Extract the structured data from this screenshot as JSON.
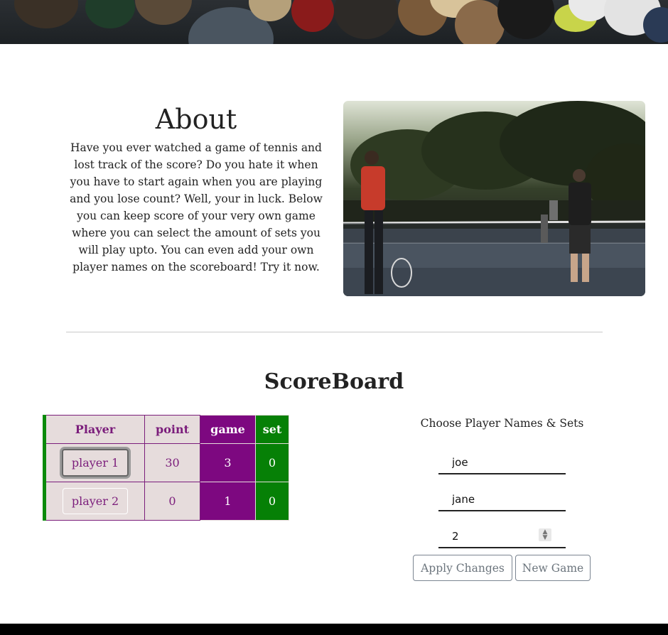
{
  "about": {
    "title": "About",
    "text": "Have you ever watched a game of tennis and lost track of the score? Do you hate it when you have to start again when you are playing and you lose count? Well, your in luck. Below you can keep score of your very own game where you can select the amount of sets you will play upto. You can even add your own player names on the scoreboard! Try it now."
  },
  "scoreboard": {
    "title": "ScoreBoard",
    "headers": {
      "player": "Player",
      "point": "point",
      "game": "game",
      "set": "set"
    },
    "rows": [
      {
        "player": "player 1",
        "point": "30",
        "game": "3",
        "set": "0"
      },
      {
        "player": "player 2",
        "point": "0",
        "game": "1",
        "set": "0"
      }
    ]
  },
  "form": {
    "title": "Choose Player Names & Sets",
    "player1_value": "joe",
    "player2_value": "jane",
    "sets_value": "2",
    "apply_label": "Apply Changes",
    "new_game_label": "New Game"
  },
  "colors": {
    "purple": "#7d0880",
    "green": "#068006",
    "cell_bg": "#e6dcdc"
  }
}
